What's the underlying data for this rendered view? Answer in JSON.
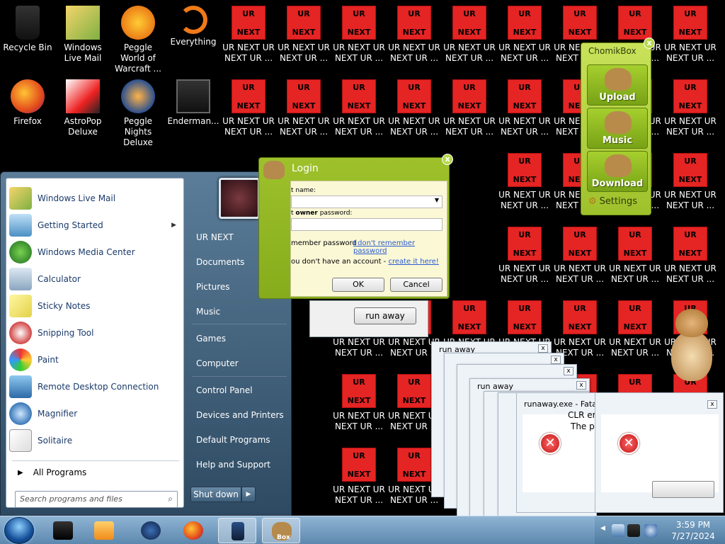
{
  "desktop_icons": [
    {
      "label": "Recycle Bin"
    },
    {
      "label": "Windows Live Mail"
    },
    {
      "label": "Peggle World of Warcraft ..."
    },
    {
      "label": "Everything"
    },
    {
      "label": "Firefox"
    },
    {
      "label": "AstroPop Deluxe"
    },
    {
      "label": "Peggle Nights Deluxe"
    },
    {
      "label": "Enderman..."
    }
  ],
  "ur_icon": {
    "top_text": "UR",
    "bottom_text": "NEXT",
    "label": "UR NEXT UR NEXT UR ..."
  },
  "start_menu": {
    "left_items": [
      {
        "label": "Windows Live Mail"
      },
      {
        "label": "Getting Started",
        "has_submenu": true
      },
      {
        "label": "Windows Media Center"
      },
      {
        "label": "Calculator"
      },
      {
        "label": "Sticky Notes"
      },
      {
        "label": "Snipping Tool"
      },
      {
        "label": "Paint"
      },
      {
        "label": "Remote Desktop Connection"
      },
      {
        "label": "Magnifier"
      },
      {
        "label": "Solitaire"
      }
    ],
    "all_programs": "All Programs",
    "search_placeholder": "Search programs and files",
    "right_items": [
      {
        "label": "UR NEXT"
      },
      {
        "label": "Documents"
      },
      {
        "label": "Pictures"
      },
      {
        "label": "Music"
      },
      {
        "label": "Games"
      },
      {
        "label": "Computer"
      },
      {
        "label": "Control Panel"
      },
      {
        "label": "Devices and Printers"
      },
      {
        "label": "Default Programs"
      },
      {
        "label": "Help and Support"
      }
    ],
    "shutdown_label": "Shut down",
    "shutdown_arrow": "▶"
  },
  "login_dialog": {
    "title": "Login",
    "close": "x",
    "user_label": "t name:",
    "password_label_pre": "t ",
    "password_label_bold": "owner",
    "password_label_post": " password:",
    "remember_label": "member password",
    "forgot_link": "I don't remember password",
    "no_account_text": "ou don't have an account - ",
    "create_link": "create it here!",
    "ok_button": "OK",
    "cancel_button": "Cancel"
  },
  "runaway_window": {
    "button": "run away"
  },
  "chomikbox": {
    "title": "ChomikBox",
    "close": "x",
    "buttons": [
      {
        "label": "Upload"
      },
      {
        "label": "Music"
      },
      {
        "label": "Download"
      }
    ],
    "settings": "Settings"
  },
  "error_windows": {
    "cascade_captions": [
      "run away",
      "",
      "",
      "run away",
      "",
      ""
    ],
    "main_caption": "runaway.exe - Fata",
    "main_msg1": "CLR err",
    "main_msg2": "The pr",
    "close_glyph": "x"
  },
  "taskbar": {
    "clock_time": "3:59 PM",
    "clock_date": "7/27/2024",
    "box_label": "Box"
  },
  "colors": {
    "ur_red": "#e52424",
    "chomik_green": "#9ec12b",
    "taskbar_blue": "#5d88ae"
  }
}
